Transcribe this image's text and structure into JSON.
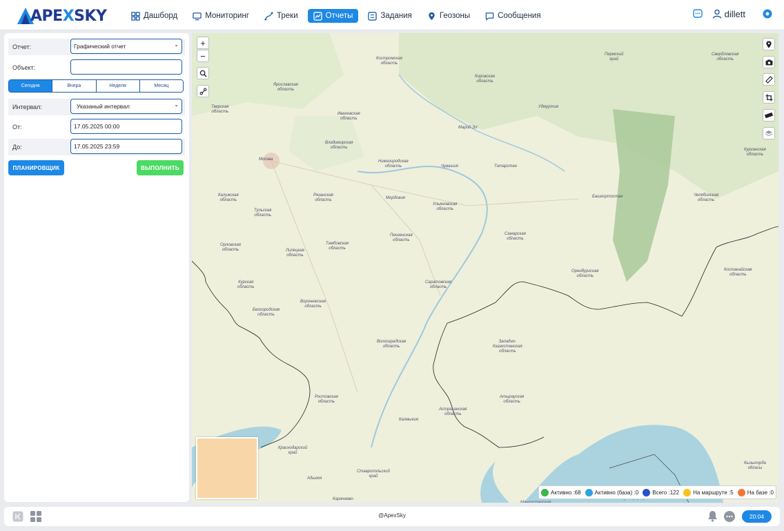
{
  "header": {
    "logo": {
      "prefix": "APE",
      "x": "X",
      "suffix": "SKY"
    },
    "nav": [
      {
        "label": "Дашборд",
        "icon": "dashboard-icon",
        "active": false
      },
      {
        "label": "Мониторинг",
        "icon": "monitor-icon",
        "active": false
      },
      {
        "label": "Треки",
        "icon": "track-icon",
        "active": false
      },
      {
        "label": "Отчеты",
        "icon": "chart-icon",
        "active": true
      },
      {
        "label": "Задания",
        "icon": "tasks-icon",
        "active": false
      },
      {
        "label": "Геозоны",
        "icon": "geozone-icon",
        "active": false
      },
      {
        "label": "Сообщения",
        "icon": "message-icon",
        "active": false
      }
    ],
    "username": "dillett"
  },
  "form": {
    "report_label": "Отчет:",
    "report_value": "Графический отчет",
    "object_label": "Объект:",
    "object_value": "",
    "periods": [
      "Сегодня",
      "Вчера",
      "Неделя",
      "Месяц"
    ],
    "active_period": "Сегодня",
    "interval_label": "Интервал:",
    "interval_value": "Указаный интервал",
    "from_label": "От:",
    "from_value": "17.05.2025 00:00",
    "to_label": "До:",
    "to_value": "17.05.2025 23:59",
    "scheduler_label": "ПЛАНИРОВЩИК",
    "run_label": "ВЫПОЛНИТЬ"
  },
  "map": {
    "labels": [
      {
        "text": "Костромская\nобласть"
      },
      {
        "text": "Ярославская\nобласть"
      },
      {
        "text": "Кировская\nобласть"
      },
      {
        "text": "Пермский\nкрай"
      },
      {
        "text": "Свердловская\nобласть"
      },
      {
        "text": "Тверская\nобласть"
      },
      {
        "text": "Ивановская\nобласть"
      },
      {
        "text": "Удмуртия"
      },
      {
        "text": "Марий Эл"
      },
      {
        "text": "Владимирская\nобласть"
      },
      {
        "text": "Нижегородская\nобласть"
      },
      {
        "text": "Чувашия"
      },
      {
        "text": "Татарстан"
      },
      {
        "text": "Курганская\nобласть"
      },
      {
        "text": "Москва"
      },
      {
        "text": "Калужская\nобласть"
      },
      {
        "text": "Рязанская\nобласть"
      },
      {
        "text": "Мордовия"
      },
      {
        "text": "Башкортостан"
      },
      {
        "text": "Челябинская\nобласть"
      },
      {
        "text": "Тульская\nобласть"
      },
      {
        "text": "Ульяновская\nобласть"
      },
      {
        "text": "Пензенская\nобласть"
      },
      {
        "text": "Самарская\nобласть"
      },
      {
        "text": "Орловская\nобласть"
      },
      {
        "text": "Липецкая\nобласть"
      },
      {
        "text": "Тамбовская\nобласть"
      },
      {
        "text": "Оренбургская\nобласть"
      },
      {
        "text": "Костанайская\nобласть"
      },
      {
        "text": "Курская\nобласть"
      },
      {
        "text": "Саратовская\nобласть"
      },
      {
        "text": "Воронежская\nобласть"
      },
      {
        "text": "Белгородская\nобласть"
      },
      {
        "text": "Западно-\nКазахстанская\nобласть"
      },
      {
        "text": "Волгоградская\nобласть"
      },
      {
        "text": "Ростовская\nобласть"
      },
      {
        "text": "Атырауская\nобласть"
      },
      {
        "text": "Астраханская\nобласть"
      },
      {
        "text": "Калмыкия"
      },
      {
        "text": "Краснодарский\nкрай"
      },
      {
        "text": "Ставропольский\nкрай"
      },
      {
        "text": "Адыгея"
      },
      {
        "text": "Карачаево-"
      },
      {
        "text": "Мангистауская"
      },
      {
        "text": "Qaraqalpaqstan"
      },
      {
        "text": "Кызылорда\nобласы"
      }
    ],
    "right_tools": [
      "pin-icon",
      "camera-icon",
      "ruler-icon",
      "crop-icon",
      "measure-icon",
      "layers-icon"
    ],
    "legend": [
      {
        "label": "Активно :68",
        "color": "#3cb54a"
      },
      {
        "label": "Активно (база) :0",
        "color": "#2ea3dd"
      },
      {
        "label": "Всего :122",
        "color": "#2452c9"
      },
      {
        "label": "На маршруте :5",
        "color": "#f6c21c"
      },
      {
        "label": "На базе :0",
        "color": "#f37636"
      }
    ]
  },
  "footer": {
    "copyright": "@ApexSky",
    "time": "20:04"
  },
  "colors": {
    "accent": "#1e88e5",
    "run": "#4cd964"
  }
}
